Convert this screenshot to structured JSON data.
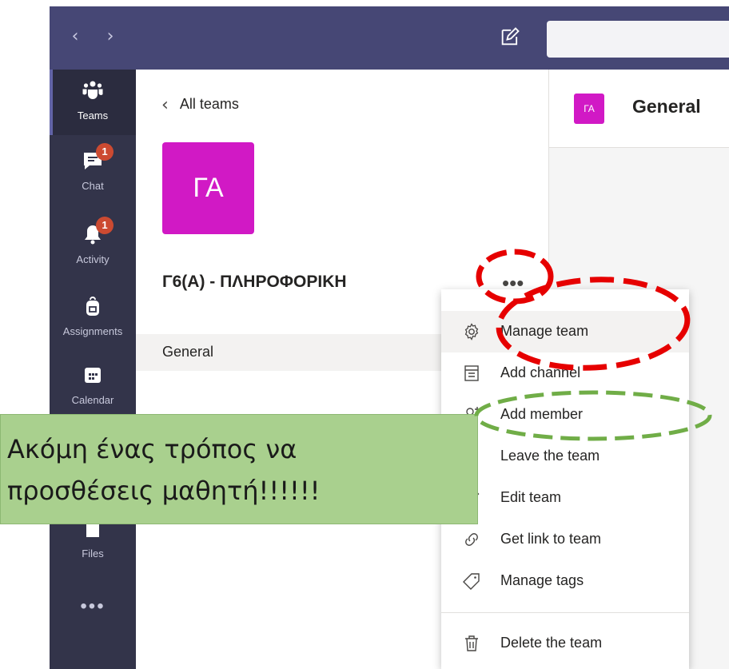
{
  "rail": {
    "items": [
      {
        "label": "Teams",
        "icon": "teams-icon",
        "active": true
      },
      {
        "label": "Chat",
        "icon": "chat-icon",
        "badge": "1"
      },
      {
        "label": "Activity",
        "icon": "bell-icon",
        "badge": "1"
      },
      {
        "label": "Assignments",
        "icon": "backpack-icon"
      },
      {
        "label": "Calendar",
        "icon": "calendar-icon"
      },
      {
        "label": "Files",
        "icon": "file-icon"
      }
    ],
    "more": "•••"
  },
  "team_panel": {
    "back_label": "All teams",
    "team_initials": "ΓΑ",
    "team_name": "Γ6(Α) - ΠΛΗΡΟΦΟΡΙΚΗ",
    "more_label": "•••",
    "channels": [
      {
        "name": "General"
      }
    ]
  },
  "content": {
    "initials": "ΓΑ",
    "channel_title": "General"
  },
  "menu": {
    "items": [
      {
        "label": "Manage team",
        "icon": "gear-icon"
      },
      {
        "label": "Add channel",
        "icon": "add-channel-icon"
      },
      {
        "label": "Add member",
        "icon": "add-member-icon"
      },
      {
        "label": "Leave the team",
        "icon": "leave-icon"
      },
      {
        "label": "Edit team",
        "icon": "pencil-icon"
      },
      {
        "label": "Get link to team",
        "icon": "link-icon"
      },
      {
        "label": "Manage tags",
        "icon": "tag-icon"
      },
      {
        "label": "Delete the team",
        "icon": "trash-icon"
      }
    ]
  },
  "callout": {
    "line1": "Ακόμη ένας τρόπος να",
    "line2": "προσθέσεις μαθητή!!!!!!"
  },
  "colors": {
    "titlebar": "#464775",
    "rail": "#33344a",
    "team_avatar": "#d119c5",
    "red_annotation": "#e60000",
    "green_annotation": "#70ad47",
    "callout_bg": "#a9d08e"
  }
}
